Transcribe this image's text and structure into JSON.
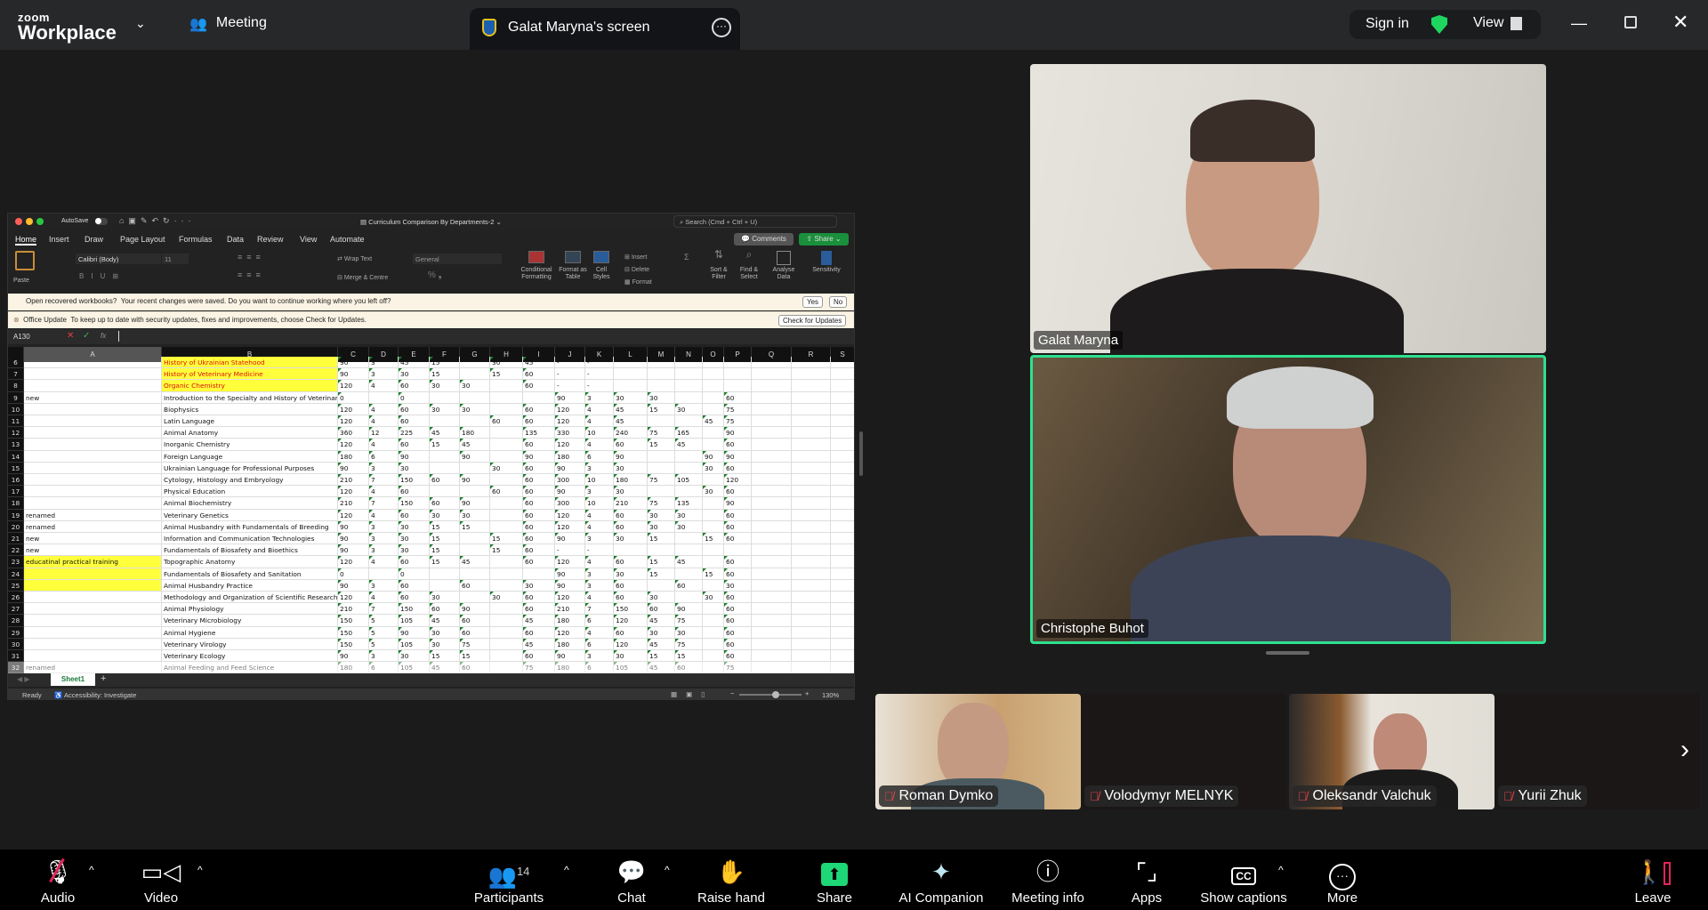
{
  "topbar": {
    "logo_small": "zoom",
    "logo_big": "Workplace",
    "meeting_label": "Meeting",
    "share_tab": "Galat Maryna's screen",
    "sign_in": "Sign in",
    "view": "View"
  },
  "excel": {
    "autosave": "AutoSave",
    "file_title": "Curriculum Comparison By Departments-2",
    "search_placeholder": "Search (Cmd + Ctrl + U)",
    "tabs": [
      "Home",
      "Insert",
      "Draw",
      "Page Layout",
      "Formulas",
      "Data",
      "Review",
      "View",
      "Automate"
    ],
    "comments": "Comments",
    "share": "Share",
    "ribbon": {
      "paste": "Paste",
      "font": "Calibri (Body)",
      "size": "11",
      "wrap": "Wrap Text",
      "merge": "Merge & Centre",
      "number_format": "General",
      "cond": "Conditional Formatting",
      "fmt_table": "Format as Table",
      "cell_styles": "Cell Styles",
      "insert": "Insert",
      "delete": "Delete",
      "format": "Format",
      "sort": "Sort & Filter",
      "find": "Find & Select",
      "analyse": "Analyse Data",
      "sensitivity": "Sensitivity"
    },
    "recover": {
      "title": "Open recovered workbooks?",
      "text": "Your recent changes were saved. Do you want to continue working where you left off?",
      "yes": "Yes",
      "no": "No"
    },
    "update": {
      "title": "Office Update",
      "text": "To keep up to date with security updates, fixes and improvements, choose Check for Updates.",
      "button": "Check for Updates"
    },
    "name_box": "A130",
    "fx": "fx",
    "columns": [
      "A",
      "B",
      "C",
      "D",
      "E",
      "F",
      "G",
      "H",
      "I",
      "J",
      "K",
      "L",
      "M",
      "N",
      "O",
      "P",
      "Q",
      "R",
      "S"
    ],
    "rows": [
      {
        "n": 6,
        "a": "",
        "b": "History of Ukrainian Statehood",
        "v": [
          "90",
          "3",
          "45",
          "15",
          "",
          "30",
          "45",
          "-",
          "-",
          "",
          "",
          "",
          "",
          ""
        ]
      },
      {
        "n": 7,
        "a": "",
        "b": "History of Veterinary Medicine",
        "v": [
          "90",
          "3",
          "30",
          "15",
          "",
          "15",
          "60",
          "-",
          "-",
          "",
          "",
          "",
          "",
          ""
        ]
      },
      {
        "n": 8,
        "a": "",
        "b": "Organic Chemistry",
        "v": [
          "120",
          "4",
          "60",
          "30",
          "30",
          "",
          "60",
          "-",
          "-",
          "",
          "",
          "",
          "",
          ""
        ]
      },
      {
        "n": 9,
        "a": "new",
        "b": "Introduction to the Specialty and History of Veterinary Medicine",
        "v": [
          "0",
          "",
          "0",
          "",
          "",
          "",
          "",
          "90",
          "3",
          "30",
          "30",
          "",
          "",
          "60"
        ]
      },
      {
        "n": 10,
        "a": "",
        "b": "Biophysics",
        "v": [
          "120",
          "4",
          "60",
          "30",
          "30",
          "",
          "60",
          "120",
          "4",
          "45",
          "15",
          "30",
          "",
          "75"
        ]
      },
      {
        "n": 11,
        "a": "",
        "b": "Latin Language",
        "v": [
          "120",
          "4",
          "60",
          "",
          "",
          "60",
          "60",
          "120",
          "4",
          "45",
          "",
          "",
          "45",
          "75"
        ]
      },
      {
        "n": 12,
        "a": "",
        "b": "Animal Anatomy",
        "v": [
          "360",
          "12",
          "225",
          "45",
          "180",
          "",
          "135",
          "330",
          "10",
          "240",
          "75",
          "165",
          "",
          "90"
        ]
      },
      {
        "n": 13,
        "a": "",
        "b": "Inorganic Chemistry",
        "v": [
          "120",
          "4",
          "60",
          "15",
          "45",
          "",
          "60",
          "120",
          "4",
          "60",
          "15",
          "45",
          "",
          "60"
        ]
      },
      {
        "n": 14,
        "a": "",
        "b": "Foreign Language",
        "v": [
          "180",
          "6",
          "90",
          "",
          "90",
          "",
          "90",
          "180",
          "6",
          "90",
          "",
          "",
          "90",
          "90"
        ]
      },
      {
        "n": 15,
        "a": "",
        "b": "Ukrainian Language for Professional Purposes",
        "v": [
          "90",
          "3",
          "30",
          "",
          "",
          "30",
          "60",
          "90",
          "3",
          "30",
          "",
          "",
          "30",
          "60"
        ]
      },
      {
        "n": 16,
        "a": "",
        "b": "Cytology, Histology and Embryology",
        "v": [
          "210",
          "7",
          "150",
          "60",
          "90",
          "",
          "60",
          "300",
          "10",
          "180",
          "75",
          "105",
          "",
          "120"
        ]
      },
      {
        "n": 17,
        "a": "",
        "b": "Physical Education",
        "v": [
          "120",
          "4",
          "60",
          "",
          "",
          "60",
          "60",
          "90",
          "3",
          "30",
          "",
          "",
          "30",
          "60"
        ]
      },
      {
        "n": 18,
        "a": "",
        "b": "Animal Biochemistry",
        "v": [
          "210",
          "7",
          "150",
          "60",
          "90",
          "",
          "60",
          "300",
          "10",
          "210",
          "75",
          "135",
          "",
          "90"
        ]
      },
      {
        "n": 19,
        "a": "renamed",
        "b": "Veterinary Genetics",
        "v": [
          "120",
          "4",
          "60",
          "30",
          "30",
          "",
          "60",
          "120",
          "4",
          "60",
          "30",
          "30",
          "",
          "60"
        ]
      },
      {
        "n": 20,
        "a": "renamed",
        "b": "Animal Husbandry with Fundamentals of Breeding",
        "v": [
          "90",
          "3",
          "30",
          "15",
          "15",
          "",
          "60",
          "120",
          "4",
          "60",
          "30",
          "30",
          "",
          "60"
        ]
      },
      {
        "n": 21,
        "a": "new",
        "b": "Information and Communication Technologies",
        "v": [
          "90",
          "3",
          "30",
          "15",
          "",
          "15",
          "60",
          "90",
          "3",
          "30",
          "15",
          "",
          "15",
          "60"
        ]
      },
      {
        "n": 22,
        "a": "new",
        "b": "Fundamentals of Biosafety and Bioethics",
        "v": [
          "90",
          "3",
          "30",
          "15",
          "",
          "15",
          "60",
          "-",
          "-",
          "",
          "",
          "",
          "",
          ""
        ]
      },
      {
        "n": 23,
        "a": "educatinal practical training",
        "b": "Topographic Anatomy",
        "v": [
          "120",
          "4",
          "60",
          "15",
          "45",
          "",
          "60",
          "120",
          "4",
          "60",
          "15",
          "45",
          "",
          "60"
        ]
      },
      {
        "n": 24,
        "a": "",
        "b": "Fundamentals of Biosafety and Sanitation",
        "v": [
          "0",
          "",
          "0",
          "",
          "",
          "",
          "",
          "90",
          "3",
          "30",
          "15",
          "",
          "15",
          "60"
        ]
      },
      {
        "n": 25,
        "a": "",
        "b": "Animal Husbandry Practice",
        "v": [
          "90",
          "3",
          "60",
          "",
          "60",
          "",
          "30",
          "90",
          "3",
          "60",
          "",
          "60",
          "",
          "30"
        ]
      },
      {
        "n": 26,
        "a": "",
        "b": "Methodology and Organization of Scientific Research",
        "v": [
          "120",
          "4",
          "60",
          "30",
          "",
          "30",
          "60",
          "120",
          "4",
          "60",
          "30",
          "",
          "30",
          "60"
        ]
      },
      {
        "n": 27,
        "a": "",
        "b": "Animal Physiology",
        "v": [
          "210",
          "7",
          "150",
          "60",
          "90",
          "",
          "60",
          "210",
          "7",
          "150",
          "60",
          "90",
          "",
          "60"
        ]
      },
      {
        "n": 28,
        "a": "",
        "b": "Veterinary Microbiology",
        "v": [
          "150",
          "5",
          "105",
          "45",
          "60",
          "",
          "45",
          "180",
          "6",
          "120",
          "45",
          "75",
          "",
          "60"
        ]
      },
      {
        "n": 29,
        "a": "",
        "b": "Animal Hygiene",
        "v": [
          "150",
          "5",
          "90",
          "30",
          "60",
          "",
          "60",
          "120",
          "4",
          "60",
          "30",
          "30",
          "",
          "60"
        ]
      },
      {
        "n": 30,
        "a": "",
        "b": "Veterinary Virology",
        "v": [
          "150",
          "5",
          "105",
          "30",
          "75",
          "",
          "45",
          "180",
          "6",
          "120",
          "45",
          "75",
          "",
          "60"
        ]
      },
      {
        "n": 31,
        "a": "",
        "b": "Veterinary Ecology",
        "v": [
          "90",
          "3",
          "30",
          "15",
          "15",
          "",
          "60",
          "90",
          "3",
          "30",
          "15",
          "15",
          "",
          "60"
        ]
      },
      {
        "n": 32,
        "a": "renamed",
        "b": "Animal Feeding and Feed Science",
        "v": [
          "180",
          "6",
          "105",
          "45",
          "60",
          "",
          "75",
          "180",
          "6",
          "105",
          "45",
          "60",
          "",
          "75"
        ]
      }
    ],
    "sheet_tab": "Sheet1",
    "status_ready": "Ready",
    "accessibility": "Accessibility: Investigate",
    "zoom": "130%",
    "zoom_fraction": 0.6
  },
  "video": {
    "main": [
      {
        "name": "Galat Maryna"
      },
      {
        "name": "Christophe Buhot"
      }
    ],
    "thumbs": [
      {
        "name": "Roman Dymko"
      },
      {
        "name": "Volodymyr MELNYK"
      },
      {
        "name": "Oleksandr Valchuk"
      },
      {
        "name": "Yurii Zhuk"
      }
    ]
  },
  "toolbar": {
    "audio": "Audio",
    "video": "Video",
    "participants": "Participants",
    "participants_count": "14",
    "chat": "Chat",
    "raise_hand": "Raise hand",
    "share": "Share",
    "ai": "AI Companion",
    "meeting_info": "Meeting info",
    "apps": "Apps",
    "captions": "Show captions",
    "more": "More",
    "leave": "Leave"
  },
  "colors": {
    "accent_green": "#1ed760",
    "share_green": "#12b886",
    "leave_red": "#e5245b"
  }
}
